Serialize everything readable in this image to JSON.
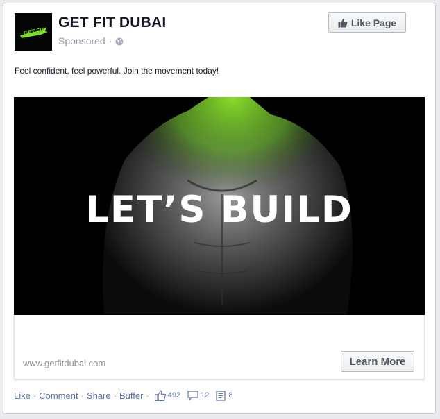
{
  "page": {
    "name": "GET FIT DUBAI",
    "sponsored_label": "Sponsored",
    "separator": "·",
    "like_page_label": "Like Page",
    "avatar_text": "GET FIT"
  },
  "post": {
    "text": "Feel confident, feel powerful. Join the movement today!",
    "hero_title": "LET’S BUILD",
    "link_domain": "www.getfitdubai.com",
    "cta_label": "Learn More"
  },
  "actions": {
    "like": "Like",
    "comment": "Comment",
    "share": "Share",
    "buffer": "Buffer",
    "sep": "·",
    "likes_count": "492",
    "comments_count": "12",
    "shares_count": "8"
  },
  "colors": {
    "brand_green": "#7ddc2a",
    "link_blue": "#5b74a8"
  },
  "icons": [
    "globe-icon",
    "thumbs-up-icon",
    "comment-icon",
    "share-icon"
  ]
}
